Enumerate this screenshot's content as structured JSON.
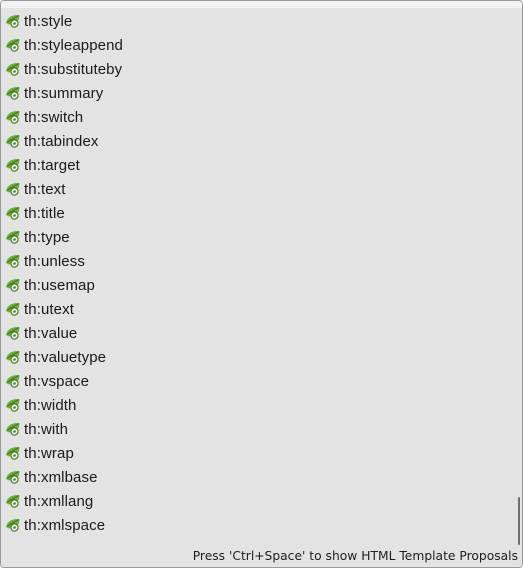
{
  "proposals": {
    "items": [
      {
        "label": "th:style",
        "icon": "green-leaf-attribute-icon"
      },
      {
        "label": "th:styleappend",
        "icon": "green-leaf-attribute-icon"
      },
      {
        "label": "th:substituteby",
        "icon": "green-leaf-attribute-icon"
      },
      {
        "label": "th:summary",
        "icon": "green-leaf-attribute-icon"
      },
      {
        "label": "th:switch",
        "icon": "green-leaf-attribute-icon"
      },
      {
        "label": "th:tabindex",
        "icon": "green-leaf-attribute-icon"
      },
      {
        "label": "th:target",
        "icon": "green-leaf-attribute-icon"
      },
      {
        "label": "th:text",
        "icon": "green-leaf-attribute-icon"
      },
      {
        "label": "th:title",
        "icon": "green-leaf-attribute-icon"
      },
      {
        "label": "th:type",
        "icon": "green-leaf-attribute-icon"
      },
      {
        "label": "th:unless",
        "icon": "green-leaf-attribute-icon"
      },
      {
        "label": "th:usemap",
        "icon": "green-leaf-attribute-icon"
      },
      {
        "label": "th:utext",
        "icon": "green-leaf-attribute-icon"
      },
      {
        "label": "th:value",
        "icon": "green-leaf-attribute-icon"
      },
      {
        "label": "th:valuetype",
        "icon": "green-leaf-attribute-icon"
      },
      {
        "label": "th:vspace",
        "icon": "green-leaf-attribute-icon"
      },
      {
        "label": "th:width",
        "icon": "green-leaf-attribute-icon"
      },
      {
        "label": "th:with",
        "icon": "green-leaf-attribute-icon"
      },
      {
        "label": "th:wrap",
        "icon": "green-leaf-attribute-icon"
      },
      {
        "label": "th:xmlbase",
        "icon": "green-leaf-attribute-icon"
      },
      {
        "label": "th:xmllang",
        "icon": "green-leaf-attribute-icon"
      },
      {
        "label": "th:xmlspace",
        "icon": "green-leaf-attribute-icon"
      }
    ],
    "scroll_position": 1.0
  },
  "status": {
    "hint": "Press 'Ctrl+Space' to show HTML Template Proposals"
  },
  "colors": {
    "background": "#e3e3e3",
    "leaf_green": "#6fae3e",
    "leaf_dark": "#3f7a1f"
  }
}
